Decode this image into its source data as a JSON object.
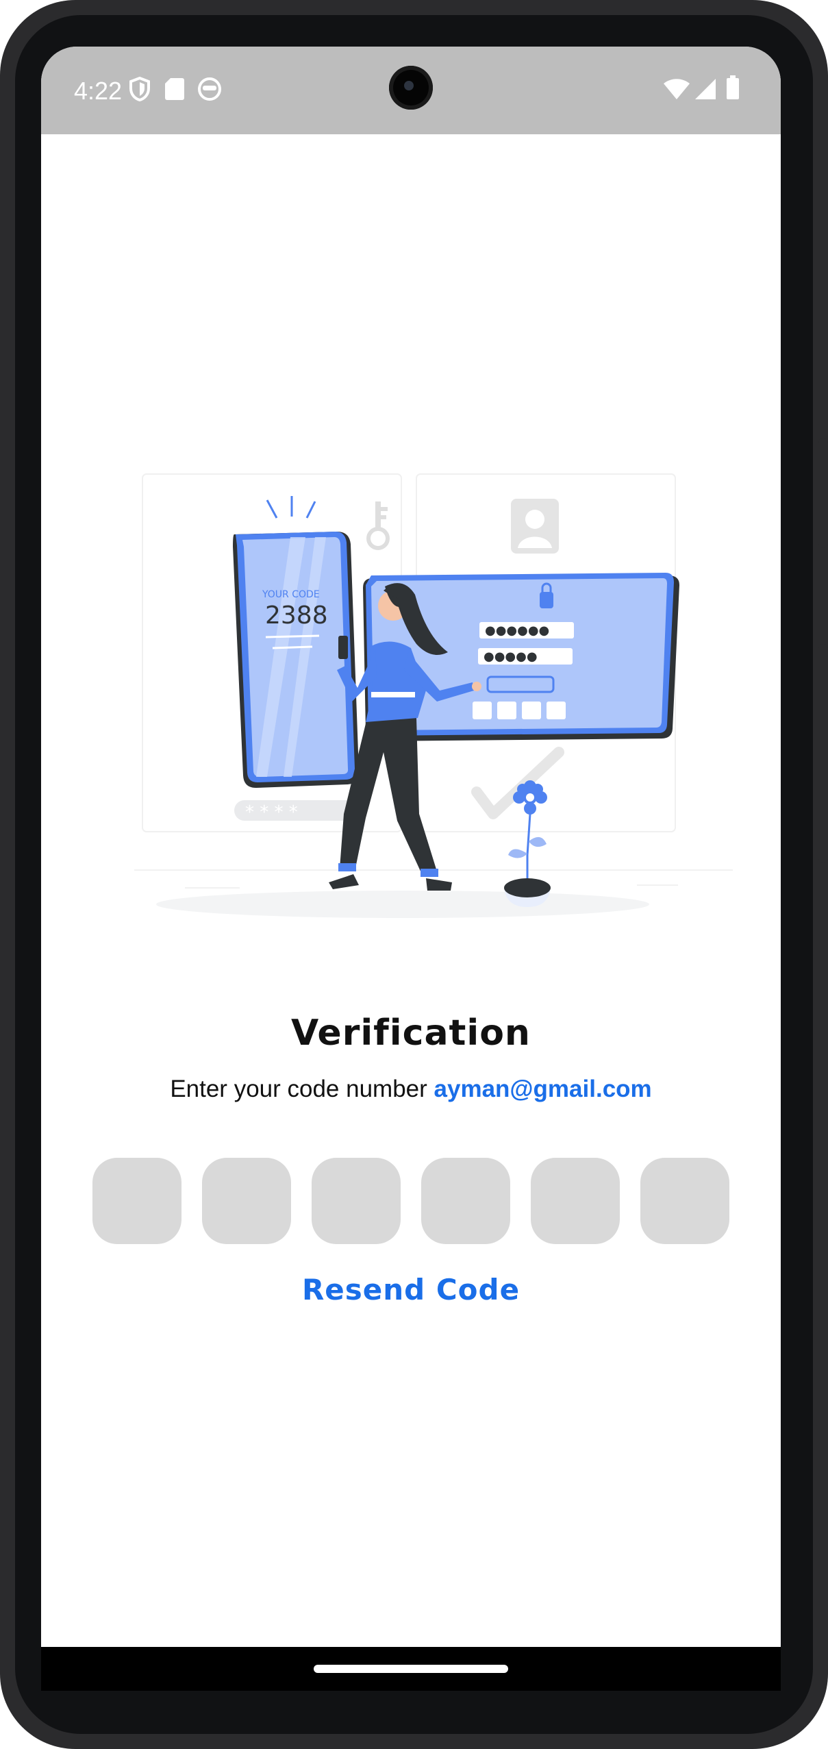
{
  "status_bar": {
    "time": "4:22",
    "left_icons": [
      "shield-icon",
      "sd-card-icon",
      "face-icon"
    ],
    "right_icons": [
      "wifi-icon",
      "cell-signal-icon",
      "battery-icon"
    ]
  },
  "illustration": {
    "phone_label": "YOUR CODE",
    "phone_code": "2388"
  },
  "verification": {
    "title": "Verification",
    "instruction": "Enter your code number",
    "email": "ayman@gmail.com"
  },
  "code_inputs": [
    "",
    "",
    "",
    "",
    "",
    ""
  ],
  "resend_label": "Resend Code",
  "colors": {
    "accent": "#1a6ee8",
    "illustration_blue": "#4f82f0",
    "box_fill": "#d9d9d9",
    "status_bar": "#bdbdbd"
  }
}
